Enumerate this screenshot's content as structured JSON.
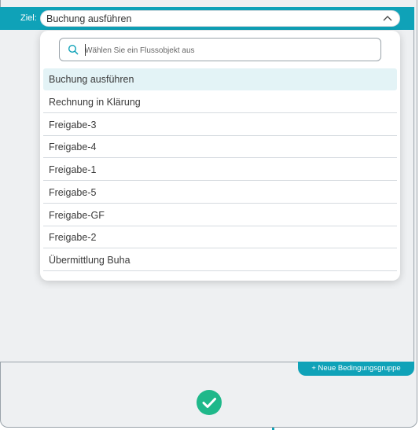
{
  "target": {
    "label": "Ziel:",
    "selected_value": "Buchung ausführen"
  },
  "search": {
    "placeholder": "Wählen Sie ein Flussobjekt aus",
    "value": ""
  },
  "options": [
    "Buchung ausführen",
    "Rechnung in Klärung",
    "Freigabe-3",
    "Freigabe-4",
    "Freigabe-1",
    "Freigabe-5",
    "Freigabe-GF",
    "Freigabe-2",
    "Übermittlung Buha"
  ],
  "selected_index": 0,
  "actions": {
    "new_condition_group": "+ Neue Bedingungsgruppe"
  },
  "icons": {
    "dropdown": "chevron-up-icon",
    "search": "search-icon",
    "confirm": "checkmark-icon"
  },
  "colors": {
    "accent": "#0fa2b8",
    "confirm": "#1fb88a",
    "selected_bg": "#e3f3f6"
  }
}
